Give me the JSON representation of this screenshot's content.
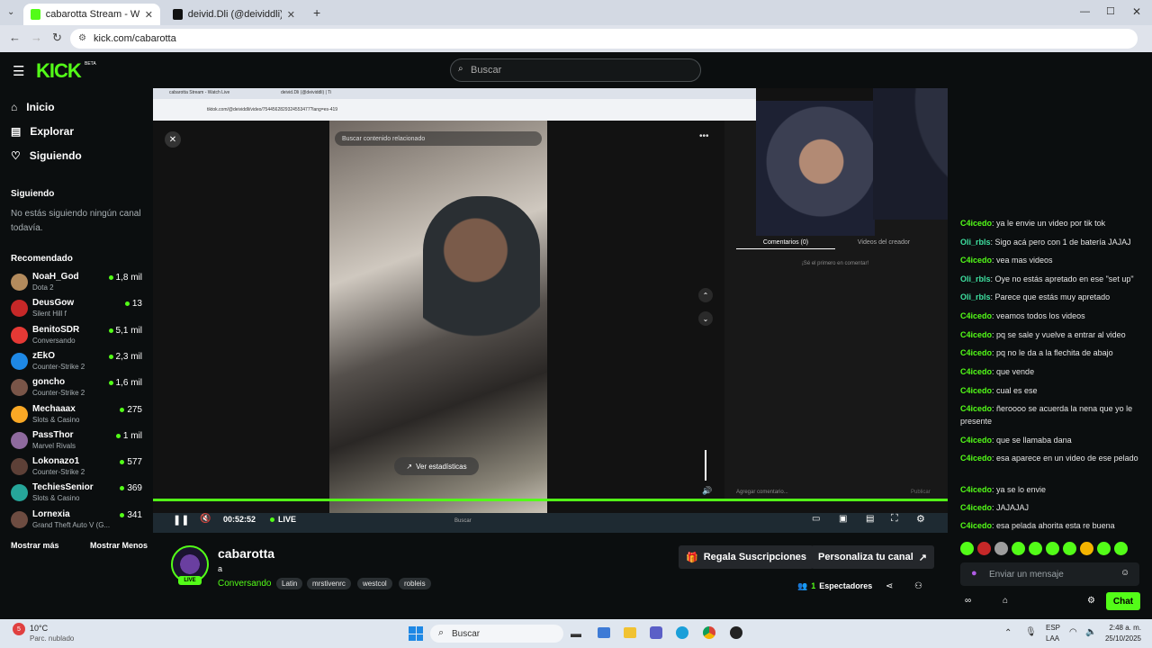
{
  "browser": {
    "tabs": [
      {
        "label": "cabarotta Stream - Watch Live o",
        "icon": "kick-favicon-icon"
      },
      {
        "label": "deivid.Dli (@deividdli) | TikTok",
        "icon": "tiktok-favicon-icon"
      }
    ],
    "url": "kick.com/cabarotta"
  },
  "kick": {
    "logo": "KICK",
    "logo_badge": "BETA",
    "search_placeholder": "Buscar",
    "brand_color": "#53fc18"
  },
  "sidebar": {
    "nav": [
      {
        "label": "Inicio",
        "icon": "home-icon"
      },
      {
        "label": "Explorar",
        "icon": "compass-icon"
      },
      {
        "label": "Siguiendo",
        "icon": "heart-icon"
      }
    ],
    "following_title": "Siguiendo",
    "following_empty": "No estás siguiendo ningún canal todavía.",
    "recommended_title": "Recomendado",
    "channels": [
      {
        "name": "NoaH_God",
        "game": "Dota 2",
        "viewers": "1,8 mil",
        "color": "#b38b5d"
      },
      {
        "name": "DeusGow",
        "game": "Silent Hill f",
        "viewers": "13",
        "color": "#c62828"
      },
      {
        "name": "BenitoSDR",
        "game": "Conversando",
        "viewers": "5,1 mil",
        "color": "#e53935"
      },
      {
        "name": "zEkO",
        "game": "Counter-Strike 2",
        "viewers": "2,3 mil",
        "color": "#1e88e5"
      },
      {
        "name": "goncho",
        "game": "Counter-Strike 2",
        "viewers": "1,6 mil",
        "color": "#795548"
      },
      {
        "name": "Mechaaax",
        "game": "Slots & Casino",
        "viewers": "275",
        "color": "#f9a825"
      },
      {
        "name": "PassThor",
        "game": "Marvel Rivals",
        "viewers": "1 mil",
        "color": "#8e6a9e"
      },
      {
        "name": "Lokonazo1",
        "game": "Counter-Strike 2",
        "viewers": "577",
        "color": "#5d4037"
      },
      {
        "name": "TechiesSenior",
        "game": "Slots & Casino",
        "viewers": "369",
        "color": "#26a69a"
      },
      {
        "name": "Lornexia",
        "game": "Grand Theft Auto V (G...",
        "viewers": "341",
        "color": "#6d4c41"
      }
    ],
    "show_more": "Mostrar más",
    "show_less": "Mostrar Menos"
  },
  "inner_screen": {
    "tabs": [
      "cabarotta Stream - Watch Live",
      "deivid.Dli (@deividdli) | Ti"
    ],
    "url": "tiktok.com/@deividdli/video/7544562829324553477?lang=es-419",
    "search_placeholder": "Buscar contenido relacionado",
    "stats_label": "Ver estadísticas",
    "comments_tab": "Comentarios (0)",
    "creator_videos_tab": "Videos del creador",
    "be_first": "¡Sé el primero en comentar!",
    "add_comment": "Agregar comentario...",
    "publish": "Publicar",
    "taskbar_search": "Buscar"
  },
  "player": {
    "time": "00:52:52",
    "live_label": "LIVE",
    "progress": 1.0
  },
  "stream": {
    "channel": "cabarotta",
    "title": "a",
    "category": "Conversando",
    "tags": [
      "Latin",
      "mrstivenrc",
      "westcol",
      "robleis"
    ],
    "live_badge": "LIVE",
    "viewers_count": "1",
    "viewers_label": "Espectadores",
    "gift_button": "Regala Suscripciones",
    "customize_button": "Personaliza tu canal"
  },
  "chat": {
    "messages": [
      {
        "user": "C4icedo",
        "text": "ya le envie un video por tik tok",
        "color": "#53fc18"
      },
      {
        "user": "Oli_rbls",
        "text": "Sigo acá pero con 1 de batería JAJAJ",
        "color": "#3ee0a0"
      },
      {
        "user": "C4icedo",
        "text": "vea mas videos",
        "color": "#53fc18"
      },
      {
        "user": "Oli_rbls",
        "text": "Oye no estás apretado en ese \"set up\"",
        "color": "#3ee0a0"
      },
      {
        "user": "Oli_rbls",
        "text": "Parece que estás muy apretado",
        "color": "#3ee0a0"
      },
      {
        "user": "C4icedo",
        "text": "veamos todos los videos",
        "color": "#53fc18"
      },
      {
        "user": "C4icedo",
        "text": "pq se sale y vuelve a entrar al video",
        "color": "#53fc18"
      },
      {
        "user": "C4icedo",
        "text": "pq no le da a la flechita de abajo",
        "color": "#53fc18"
      },
      {
        "user": "C4icedo",
        "text": "que vende",
        "color": "#53fc18"
      },
      {
        "user": "C4icedo",
        "text": "cual es ese",
        "color": "#53fc18"
      },
      {
        "user": "C4icedo",
        "text": "ñeroooo se acuerda la nena que yo le presente",
        "color": "#53fc18"
      },
      {
        "user": "C4icedo",
        "text": "que se llamaba dana",
        "color": "#53fc18"
      },
      {
        "user": "C4icedo",
        "text": "esa aparece en un video de ese pelado",
        "color": "#53fc18"
      },
      {
        "user": "C4icedo",
        "text": "ya se lo envie",
        "color": "#53fc18"
      },
      {
        "user": "C4icedo",
        "text": "JAJAJAJ",
        "color": "#53fc18"
      },
      {
        "user": "C4icedo",
        "text": "esa pelada ahorita esta re buena",
        "color": "#53fc18"
      }
    ],
    "input_placeholder": "Enviar un mensaje",
    "send_label": "Chat"
  },
  "taskbar": {
    "weather_temp": "10°C",
    "weather_desc": "Parc. nublado",
    "weather_badge": "5",
    "search": "Buscar",
    "lang": "ESP",
    "lang_sub": "LAA",
    "time": "2:48 a. m.",
    "date": "25/10/2025"
  }
}
